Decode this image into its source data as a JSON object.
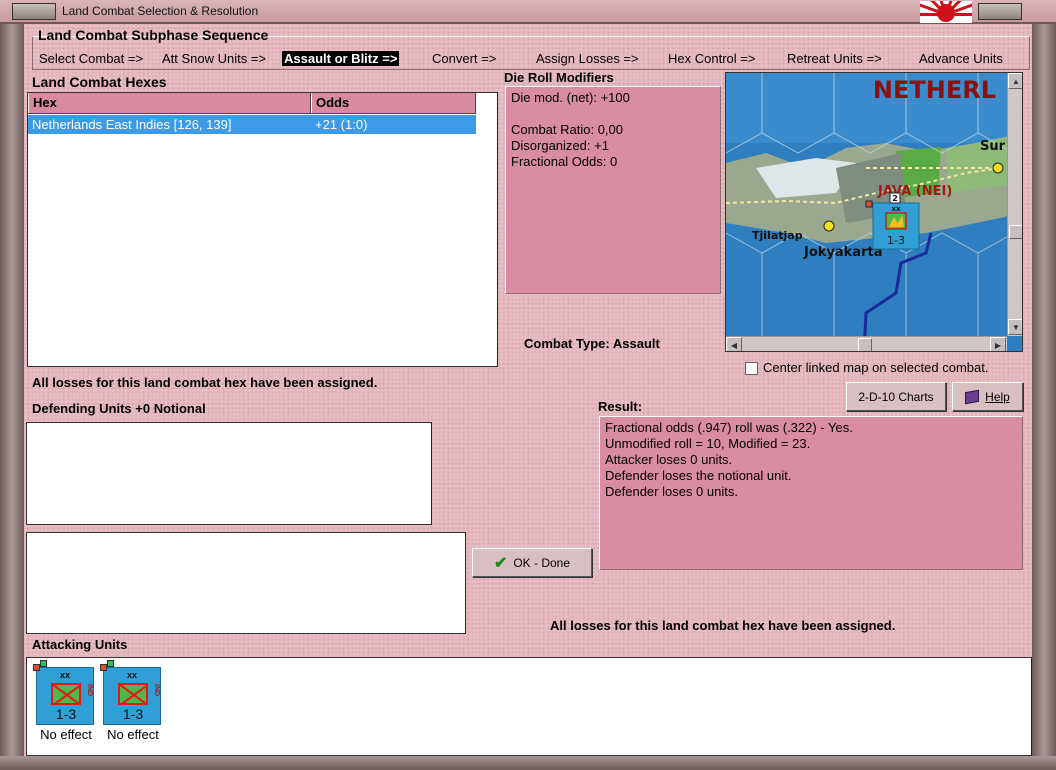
{
  "window": {
    "title": "Land Combat Selection & Resolution"
  },
  "sequence": {
    "title": "Land Combat Subphase Sequence",
    "items": [
      "Select Combat =>",
      "Att Snow Units =>",
      "Assault or Blitz =>",
      "Convert =>",
      "Assign Losses =>",
      "Hex Control =>",
      "Retreat Units =>",
      "Advance Units"
    ],
    "active_index": 2
  },
  "hexes": {
    "label": "Land Combat Hexes",
    "columns": [
      "Hex",
      "Odds"
    ],
    "rows": [
      {
        "hex": "Netherlands East Indies [126, 139]",
        "odds": "+21 (1:0)"
      }
    ]
  },
  "modifiers": {
    "label": "Die Roll Modifiers",
    "lines": [
      "Die mod. (net): +100",
      "",
      "Combat Ratio: 0,00",
      "Disorganized: +1",
      "Fractional Odds: 0"
    ]
  },
  "map": {
    "title": "NETHERL",
    "labels": {
      "java": "JAVA (NEI)",
      "city1": "Tjilatjap",
      "city2": "Jokyakarta",
      "city3": "Sur"
    },
    "unit": {
      "size": "xx",
      "strength": "1-3",
      "stack": "2"
    }
  },
  "combat_type": {
    "label": "Combat Type:",
    "value": "Assault"
  },
  "center_map": {
    "label": "Center linked map on selected combat.",
    "checked": false
  },
  "buttons": {
    "charts": "2-D-10 Charts",
    "help": "Help",
    "ok": "OK - Done"
  },
  "losses_message": "All losses for this land combat hex have been assigned.",
  "defending": {
    "label": "Defending Units +0 Notional"
  },
  "result": {
    "label": "Result:",
    "lines": [
      "Fractional odds (.947) roll was (.322)  - Yes.",
      "Unmodified roll = 10, Modified = 23.",
      "Attacker loses 0 units.",
      "Defender loses the notional unit.",
      "Defender loses 0 units."
    ]
  },
  "attacking": {
    "label": "Attacking Units",
    "units": [
      {
        "size": "xx",
        "strength": "1-3",
        "nation": "IND",
        "status": "No effect"
      },
      {
        "size": "xx",
        "strength": "1-3",
        "nation": "IND",
        "status": "No effect"
      }
    ]
  },
  "colors": {
    "panel_pink": "#d98ca2",
    "selection_blue": "#3d9ae8",
    "unit_blue": "#2f9fd6"
  }
}
